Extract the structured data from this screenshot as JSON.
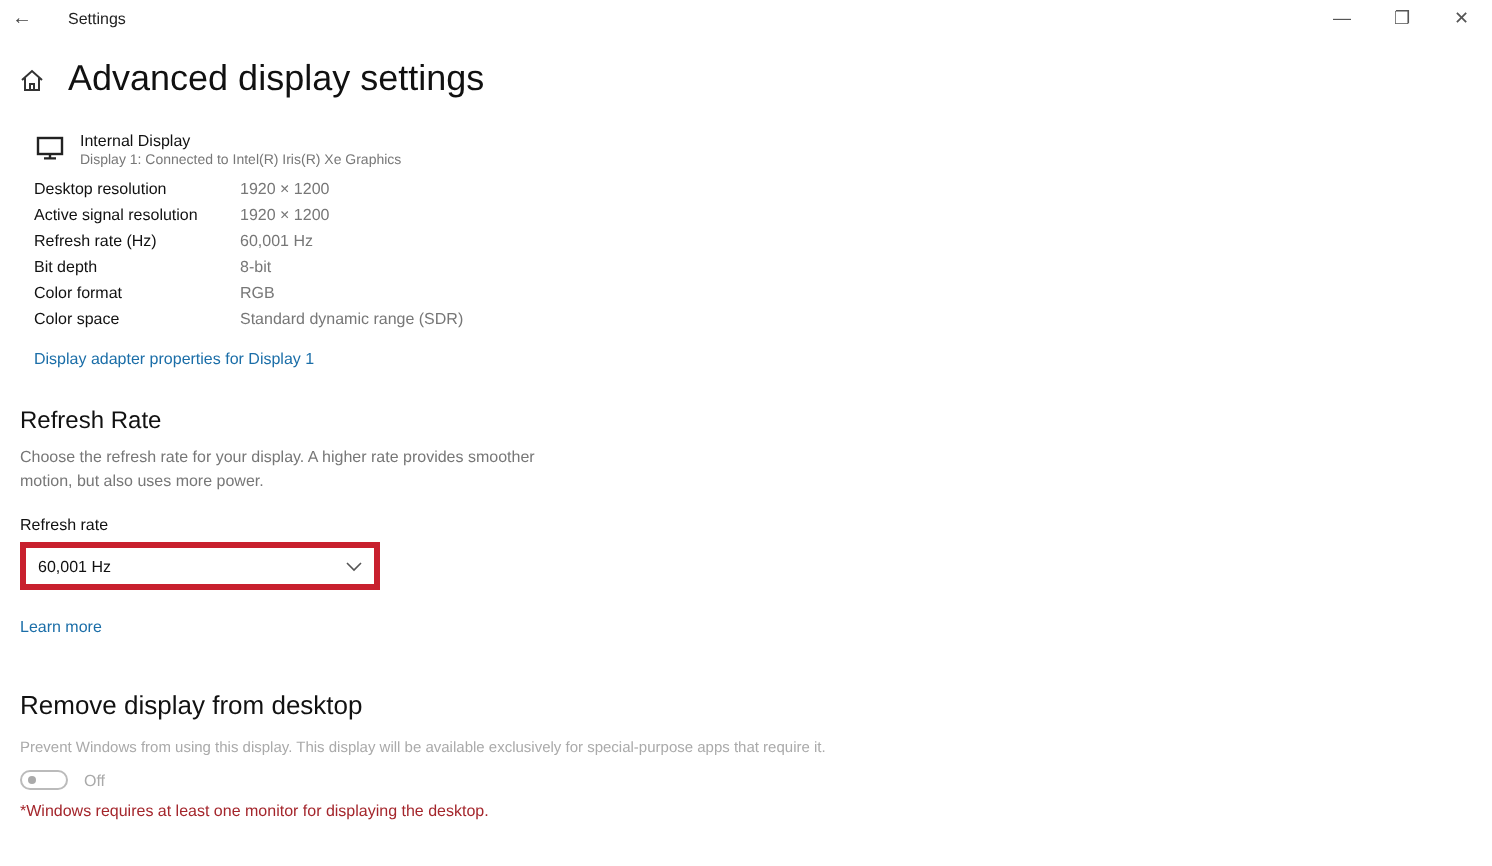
{
  "window": {
    "title": "Settings",
    "back": "←",
    "controls": [
      "—",
      "❐",
      "✕"
    ]
  },
  "heading": "Advanced display settings",
  "display": {
    "name": "Internal Display",
    "subtitle": "Display 1: Connected to Intel(R) Iris(R) Xe Graphics"
  },
  "properties": [
    {
      "label": "Desktop resolution",
      "value": "1920 × 1200"
    },
    {
      "label": "Active signal resolution",
      "value": "1920 × 1200"
    },
    {
      "label": "Refresh rate (Hz)",
      "value": "60,001 Hz"
    },
    {
      "label": "Bit depth",
      "value": "8-bit"
    },
    {
      "label": "Color format",
      "value": "RGB"
    },
    {
      "label": "Color space",
      "value": "Standard dynamic range (SDR)"
    }
  ],
  "adapter_link": "Display adapter properties for Display 1",
  "refresh_section": {
    "title": "Refresh Rate",
    "description": "Choose the refresh rate for your display. A higher rate provides smoother motion, but also uses more power.",
    "field_label": "Refresh rate",
    "dropdown": {
      "value": "60,001 Hz",
      "highlighted": true
    },
    "link": "Learn more"
  },
  "remove_section": {
    "title": "Remove display from desktop",
    "description": "Prevent Windows from using this display. This display will be available exclusively for special-purpose apps that require it.",
    "toggle": {
      "on": false,
      "disabled": true,
      "label": "Off"
    },
    "warning": "*Windows requires at least one monitor for displaying the desktop."
  }
}
